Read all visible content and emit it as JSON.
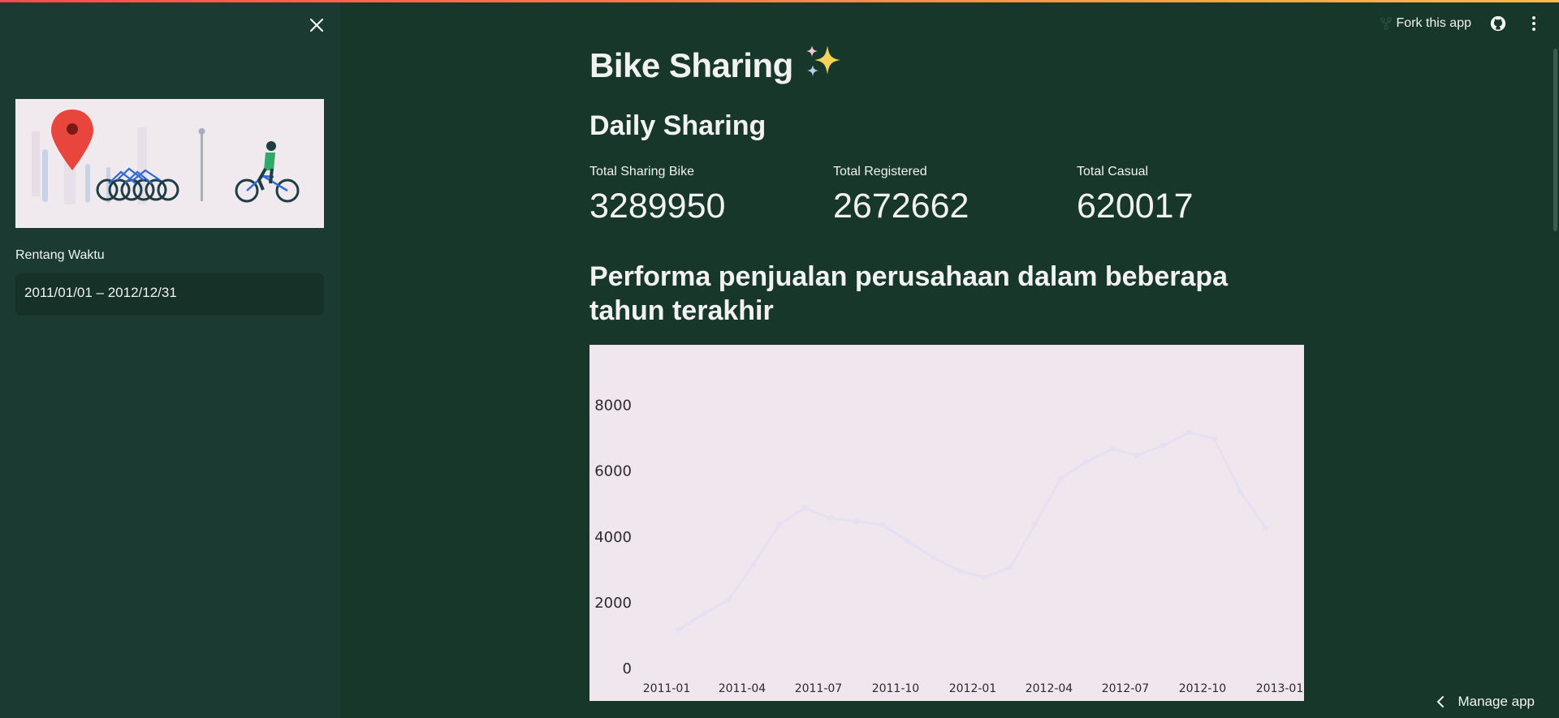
{
  "app": {
    "title": "Bike Sharing",
    "title_emoji": "sparkles-icon"
  },
  "sidebar": {
    "date_label": "Rentang Waktu",
    "date_value": "2011/01/01 – 2012/12/31"
  },
  "toolbar": {
    "fork_label": "Fork this app"
  },
  "section": {
    "title": "Daily Sharing"
  },
  "metrics": [
    {
      "label": "Total Sharing Bike",
      "value": "3289950"
    },
    {
      "label": "Total Registered",
      "value": "2672662"
    },
    {
      "label": "Total Casual",
      "value": "620017"
    }
  ],
  "chart_title": "Performa penjualan perusahaan dalam beberapa tahun terakhir",
  "footer": {
    "manage_label": "Manage app"
  },
  "colors": {
    "background": "#17372b",
    "sidebar": "#1b3a32",
    "chart_background": "#efe6ee",
    "line": "#e6e0f3"
  },
  "chart_data": {
    "type": "line",
    "title": "",
    "xlabel": "",
    "ylabel": "",
    "ylim": [
      0,
      9000
    ],
    "yticks": [
      0,
      2000,
      4000,
      6000,
      8000
    ],
    "xticks": [
      "2011-01",
      "2011-04",
      "2011-07",
      "2011-10",
      "2012-01",
      "2012-04",
      "2012-07",
      "2012-10",
      "2013-01"
    ],
    "grid": false,
    "series": [
      {
        "x": [
          "2011-01-15",
          "2011-02-15",
          "2011-03-15",
          "2011-04-15",
          "2011-05-15",
          "2011-06-15",
          "2011-07-15",
          "2011-08-15",
          "2011-09-15",
          "2011-10-15",
          "2011-11-15",
          "2011-12-15",
          "2012-01-15",
          "2012-02-15",
          "2012-03-15",
          "2012-04-15",
          "2012-05-15",
          "2012-06-15",
          "2012-07-15",
          "2012-08-15",
          "2012-09-15",
          "2012-10-15",
          "2012-11-15",
          "2012-12-15"
        ],
        "values": [
          1200,
          1700,
          2100,
          3200,
          4400,
          4900,
          4600,
          4500,
          4400,
          3900,
          3400,
          3000,
          2800,
          3100,
          4400,
          5800,
          6300,
          6700,
          6500,
          6800,
          7200,
          7000,
          5400,
          4300
        ]
      }
    ]
  }
}
